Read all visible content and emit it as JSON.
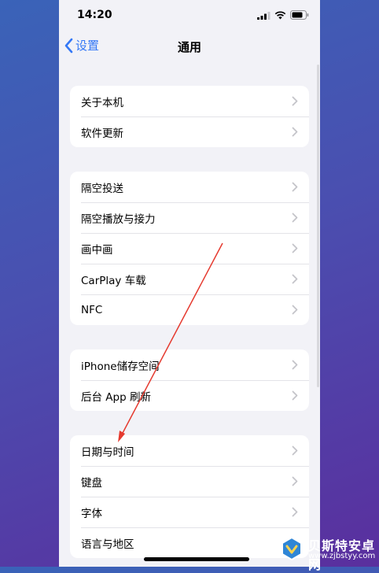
{
  "status_bar": {
    "time": "14:20"
  },
  "nav": {
    "back_label": "设置",
    "title": "通用"
  },
  "groups": [
    {
      "items": [
        {
          "label": "关于本机"
        },
        {
          "label": "软件更新"
        }
      ]
    },
    {
      "items": [
        {
          "label": "隔空投送"
        },
        {
          "label": "隔空播放与接力"
        },
        {
          "label": "画中画"
        },
        {
          "label": "CarPlay 车载"
        },
        {
          "label": "NFC"
        }
      ]
    },
    {
      "items": [
        {
          "label": "iPhone储存空间"
        },
        {
          "label": "后台 App 刷新"
        }
      ]
    },
    {
      "items": [
        {
          "label": "日期与时间"
        },
        {
          "label": "键盘"
        },
        {
          "label": "字体"
        },
        {
          "label": "语言与地区"
        }
      ]
    }
  ],
  "watermark": {
    "title": "贝斯特安卓网",
    "url": "www.zjbstyy.com"
  },
  "colors": {
    "accent": "#3478f6",
    "annotation_arrow": "#e53a2f",
    "background": "#f2f2f7"
  }
}
